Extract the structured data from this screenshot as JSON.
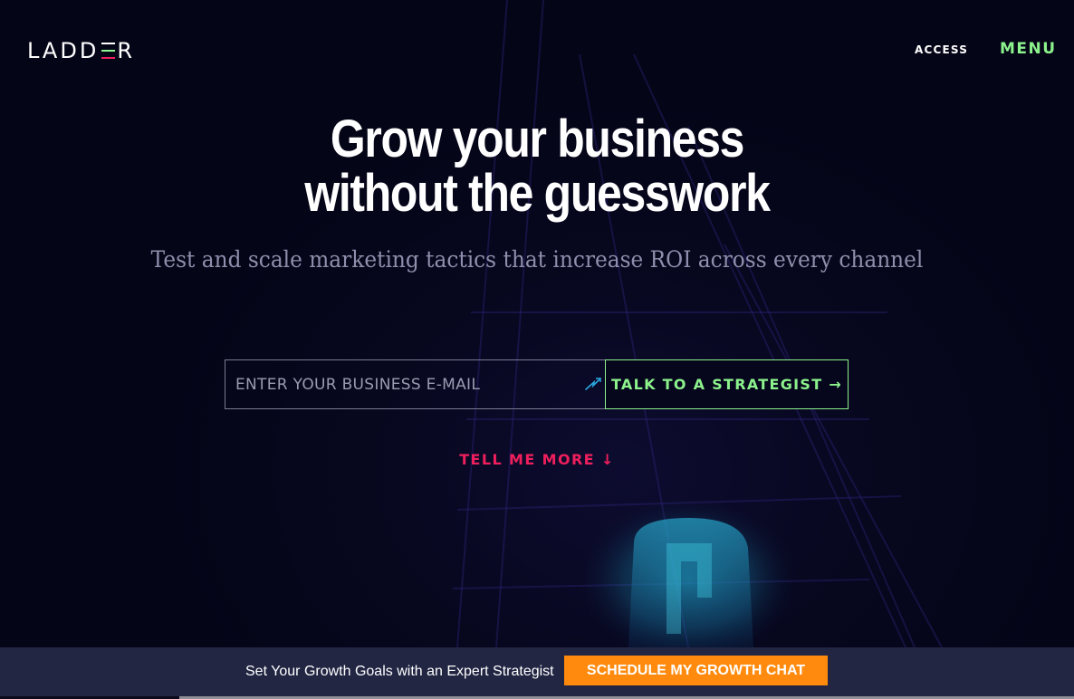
{
  "header": {
    "logo_left": "LADD",
    "logo_right": "R",
    "access_label": "ACCESS",
    "menu_label": "MENU"
  },
  "hero": {
    "headline_line1": "Grow your business",
    "headline_line2": "without the guesswork",
    "subhead": "Test and scale marketing tactics that increase ROI across every channel"
  },
  "form": {
    "email_placeholder": "ENTER YOUR BUSINESS E-MAIL",
    "email_value": "",
    "cta_label": "TALK TO A STRATEGIST →",
    "input_icon": "autofill-icon"
  },
  "tell_more_label": "TELL ME MORE ↓",
  "bottom_bar": {
    "text": "Set Your Growth Goals with an Expert Strategist",
    "button_label": "SCHEDULE MY GROWTH CHAT"
  },
  "colors": {
    "background": "#06061c",
    "accent_green": "#8cf28c",
    "accent_pink": "#ee1f5c",
    "cta_orange": "#ff8a0d",
    "bar_background": "#222643"
  }
}
